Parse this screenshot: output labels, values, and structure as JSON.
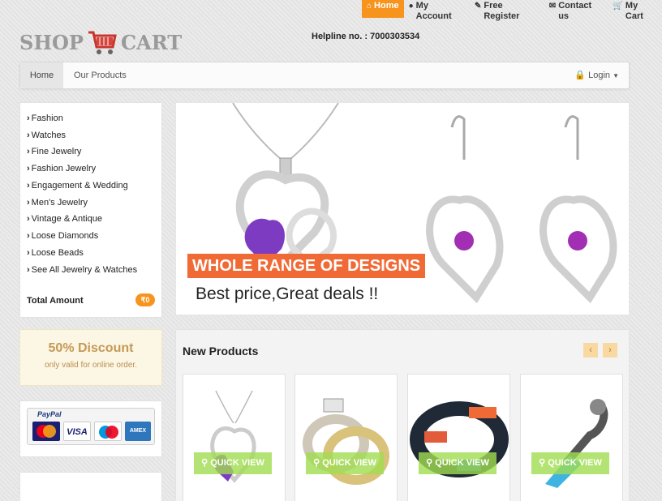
{
  "top_nav": [
    {
      "label": "Home",
      "icon": "home-icon"
    },
    {
      "label": "My Account",
      "icon": "user-icon"
    },
    {
      "label": "Free Register",
      "icon": "edit-icon"
    },
    {
      "label": "Contact us",
      "icon": "envelope-icon"
    },
    {
      "label": "My Cart",
      "icon": "cart-icon"
    }
  ],
  "logo": {
    "left": "SHOP",
    "right": "CART"
  },
  "helpline": "Helpline no. : 7000303534",
  "main_nav": {
    "home": "Home",
    "products": "Our Products",
    "login": "Login"
  },
  "categories": [
    "Fashion",
    "Watches",
    "Fine Jewelry",
    "Fashion Jewelry",
    "Engagement & Wedding",
    "Men's Jewelry",
    "Vintage & Antique",
    "Loose Diamonds",
    "Loose Beads",
    "See All Jewelry & Watches"
  ],
  "total": {
    "label": "Total Amount",
    "amount": "₹0"
  },
  "discount": {
    "title": "50% Discount",
    "subtitle": "only valid for online order."
  },
  "payment": {
    "provider": "PayPal",
    "methods": [
      "MasterCard",
      "VISA",
      "Maestro",
      "AMEX"
    ]
  },
  "banner": {
    "title": "WHOLE RANGE OF DESIGNS",
    "subtitle": "Best price,Great deals !!"
  },
  "new_products": {
    "title": "New Products",
    "prev": "‹",
    "next": "›",
    "quick_view_label": "QUICK VIEW",
    "items": [
      "necklace",
      "rings",
      "bracelet",
      "pendant"
    ]
  },
  "colors": {
    "accent": "#f7941d",
    "banner_tag": "#f06a35",
    "quick_view": "#a0dc50"
  }
}
